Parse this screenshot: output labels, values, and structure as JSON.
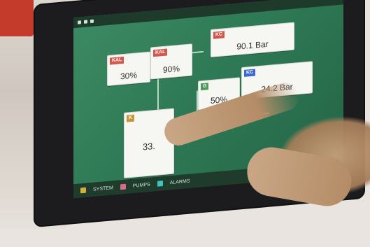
{
  "top_tiles": [
    {
      "tag": "KAL",
      "value": "30%"
    },
    {
      "tag": "KAL",
      "value": "90%"
    }
  ],
  "pressure_tiles": [
    {
      "tag": "KC",
      "value": "90.1 Bar"
    },
    {
      "tag": "KC",
      "value": "24.2 Bar"
    }
  ],
  "middle_tile": {
    "tag": "G",
    "value": "50%"
  },
  "left_tile": {
    "tag": "K",
    "value": "33."
  },
  "bottom_bar": {
    "items": [
      "SYSTEM",
      "PUMPS",
      "ALARMS"
    ]
  },
  "colors": {
    "screen_green": "#2f7a56",
    "tag_red": "#d2574d",
    "tag_green": "#4c9a57",
    "tag_blue": "#3a69d6",
    "tag_orange": "#c8953b"
  }
}
